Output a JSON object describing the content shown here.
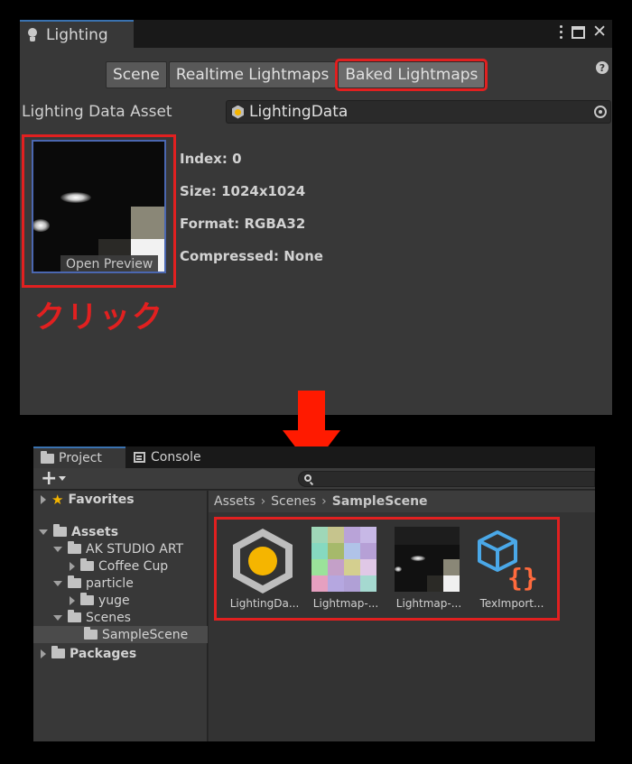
{
  "lighting_window": {
    "tab_label": "Lighting",
    "modes": [
      "Scene",
      "Realtime Lightmaps",
      "Baked Lightmaps"
    ],
    "active_mode": "Baked Lightmaps",
    "help_glyph": "?",
    "lighting_data_asset": {
      "label": "Lighting Data Asset",
      "value": "LightingData"
    },
    "preview": {
      "button_label": "Open Preview"
    },
    "info": {
      "index": "Index: 0",
      "size": "Size: 1024x1024",
      "format": "Format: RGBA32",
      "compressed": "Compressed: None"
    },
    "annotation": "クリック"
  },
  "project_window": {
    "tabs": [
      "Project",
      "Console"
    ],
    "toolbar": {
      "add_glyph": "+"
    },
    "tree": [
      {
        "label": "Favorites",
        "bold": true
      },
      {
        "label": "Assets",
        "bold": true
      },
      {
        "label": "AK STUDIO ART"
      },
      {
        "label": "Coffee Cup"
      },
      {
        "label": "particle"
      },
      {
        "label": "yuge"
      },
      {
        "label": "Scenes"
      },
      {
        "label": "SampleScene",
        "selected": true
      },
      {
        "label": "Packages",
        "bold": true
      }
    ],
    "breadcrumb": [
      "Assets",
      "Scenes",
      "SampleScene"
    ],
    "assets": [
      {
        "label": "LightingDa...",
        "icon": "lighting-data-icon"
      },
      {
        "label": "Lightmap-...",
        "icon": "lightmap-dir-thumb"
      },
      {
        "label": "Lightmap-...",
        "icon": "lightmap-light-thumb"
      },
      {
        "label": "TexImport...",
        "icon": "tex-import-icon"
      }
    ]
  },
  "colors": {
    "highlight": "#e12020",
    "arrow": "#ff1a00",
    "accent_yellow": "#f5b500",
    "tex_icon_blue": "#4aa8e8",
    "tex_icon_orange": "#ff6a3d"
  }
}
